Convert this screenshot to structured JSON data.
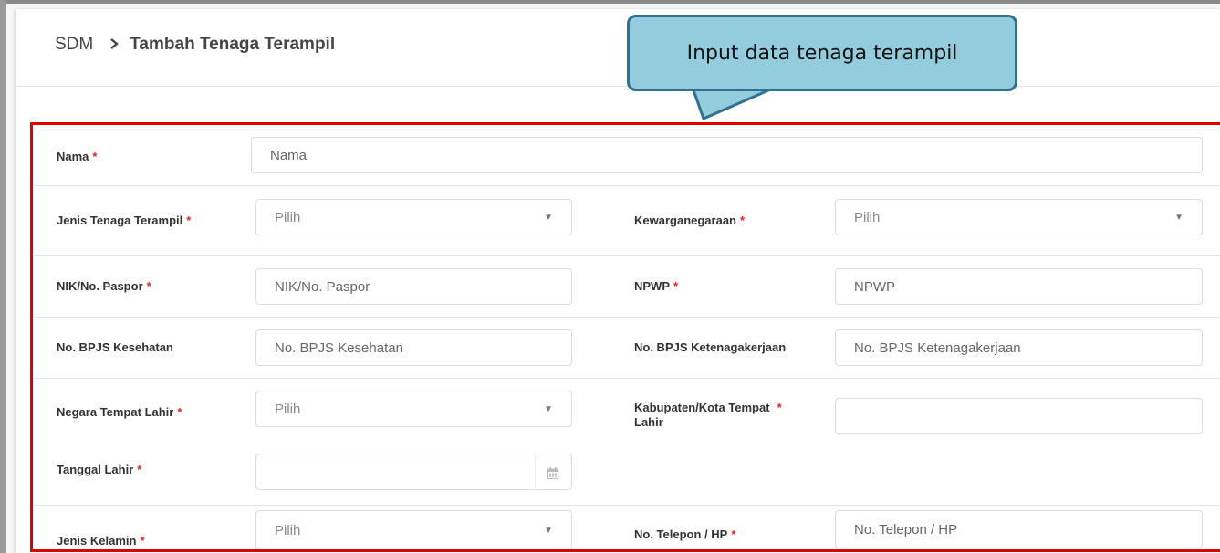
{
  "breadcrumb": {
    "root": "SDM",
    "separator": "›",
    "current": "Tambah Tenaga Terampil"
  },
  "callout": {
    "text": "Input data tenaga terampil"
  },
  "colors": {
    "callout_fill": "#93cddd",
    "callout_border": "#31708f",
    "highlight": "#e00000",
    "required": "#e02424"
  },
  "required_mark": "*",
  "form": {
    "nama": {
      "label": "Nama",
      "placeholder": "Nama"
    },
    "jenis_tenaga_terampil": {
      "label": "Jenis Tenaga Terampil",
      "value": "Pilih"
    },
    "kewarganegaraan": {
      "label": "Kewarganegaraan",
      "value": "Pilih"
    },
    "nik": {
      "label": "NIK/No. Paspor",
      "placeholder": "NIK/No. Paspor"
    },
    "npwp": {
      "label": "NPWP",
      "placeholder": "NPWP"
    },
    "bpjs_kesehatan": {
      "label": "No. BPJS Kesehatan",
      "placeholder": "No. BPJS Kesehatan"
    },
    "bpjs_ketenagakerjaan": {
      "label": "No. BPJS Ketenagakerjaan",
      "placeholder": "No. BPJS Ketenagakerjaan"
    },
    "negara_tempat_lahir": {
      "label": "Negara Tempat Lahir",
      "value": "Pilih"
    },
    "kabupaten_kota_tempat_lahir": {
      "label_line1": "Kabupaten/Kota Tempat",
      "label_line2": "Lahir",
      "value": ""
    },
    "tanggal_lahir": {
      "label": "Tanggal Lahir",
      "value": ""
    },
    "jenis_kelamin": {
      "label": "Jenis Kelamin",
      "value": "Pilih"
    },
    "no_telepon": {
      "label": "No. Telepon / HP",
      "placeholder": "No. Telepon / HP"
    }
  }
}
